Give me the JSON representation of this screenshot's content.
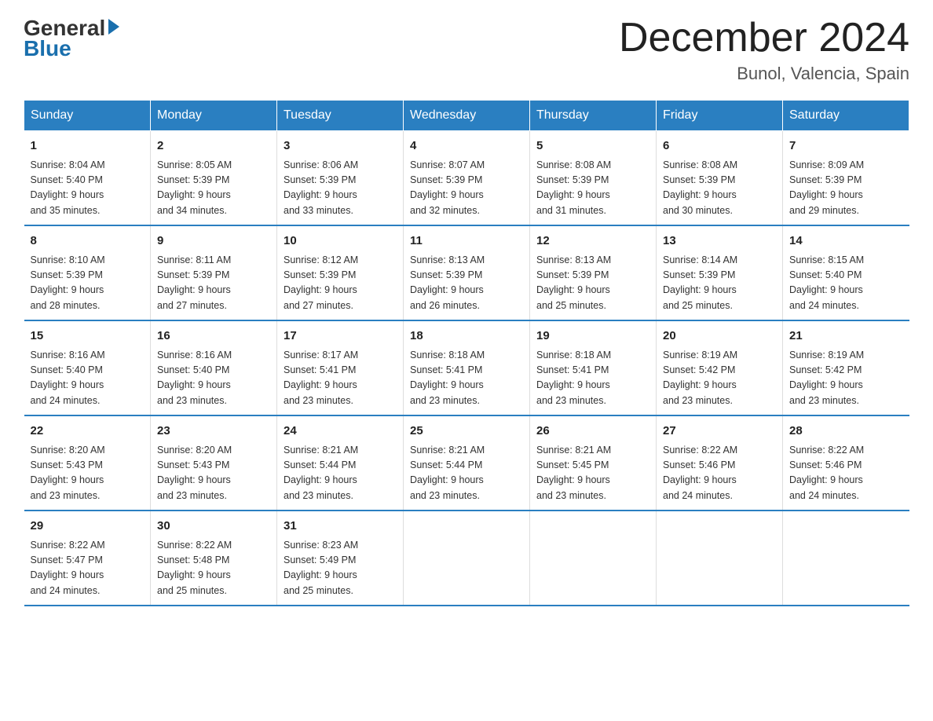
{
  "header": {
    "logo_text_general": "General",
    "logo_text_blue": "Blue",
    "month_title": "December 2024",
    "location": "Bunol, Valencia, Spain"
  },
  "days_of_week": [
    "Sunday",
    "Monday",
    "Tuesday",
    "Wednesday",
    "Thursday",
    "Friday",
    "Saturday"
  ],
  "weeks": [
    [
      {
        "day": "1",
        "info": "Sunrise: 8:04 AM\nSunset: 5:40 PM\nDaylight: 9 hours\nand 35 minutes."
      },
      {
        "day": "2",
        "info": "Sunrise: 8:05 AM\nSunset: 5:39 PM\nDaylight: 9 hours\nand 34 minutes."
      },
      {
        "day": "3",
        "info": "Sunrise: 8:06 AM\nSunset: 5:39 PM\nDaylight: 9 hours\nand 33 minutes."
      },
      {
        "day": "4",
        "info": "Sunrise: 8:07 AM\nSunset: 5:39 PM\nDaylight: 9 hours\nand 32 minutes."
      },
      {
        "day": "5",
        "info": "Sunrise: 8:08 AM\nSunset: 5:39 PM\nDaylight: 9 hours\nand 31 minutes."
      },
      {
        "day": "6",
        "info": "Sunrise: 8:08 AM\nSunset: 5:39 PM\nDaylight: 9 hours\nand 30 minutes."
      },
      {
        "day": "7",
        "info": "Sunrise: 8:09 AM\nSunset: 5:39 PM\nDaylight: 9 hours\nand 29 minutes."
      }
    ],
    [
      {
        "day": "8",
        "info": "Sunrise: 8:10 AM\nSunset: 5:39 PM\nDaylight: 9 hours\nand 28 minutes."
      },
      {
        "day": "9",
        "info": "Sunrise: 8:11 AM\nSunset: 5:39 PM\nDaylight: 9 hours\nand 27 minutes."
      },
      {
        "day": "10",
        "info": "Sunrise: 8:12 AM\nSunset: 5:39 PM\nDaylight: 9 hours\nand 27 minutes."
      },
      {
        "day": "11",
        "info": "Sunrise: 8:13 AM\nSunset: 5:39 PM\nDaylight: 9 hours\nand 26 minutes."
      },
      {
        "day": "12",
        "info": "Sunrise: 8:13 AM\nSunset: 5:39 PM\nDaylight: 9 hours\nand 25 minutes."
      },
      {
        "day": "13",
        "info": "Sunrise: 8:14 AM\nSunset: 5:39 PM\nDaylight: 9 hours\nand 25 minutes."
      },
      {
        "day": "14",
        "info": "Sunrise: 8:15 AM\nSunset: 5:40 PM\nDaylight: 9 hours\nand 24 minutes."
      }
    ],
    [
      {
        "day": "15",
        "info": "Sunrise: 8:16 AM\nSunset: 5:40 PM\nDaylight: 9 hours\nand 24 minutes."
      },
      {
        "day": "16",
        "info": "Sunrise: 8:16 AM\nSunset: 5:40 PM\nDaylight: 9 hours\nand 23 minutes."
      },
      {
        "day": "17",
        "info": "Sunrise: 8:17 AM\nSunset: 5:41 PM\nDaylight: 9 hours\nand 23 minutes."
      },
      {
        "day": "18",
        "info": "Sunrise: 8:18 AM\nSunset: 5:41 PM\nDaylight: 9 hours\nand 23 minutes."
      },
      {
        "day": "19",
        "info": "Sunrise: 8:18 AM\nSunset: 5:41 PM\nDaylight: 9 hours\nand 23 minutes."
      },
      {
        "day": "20",
        "info": "Sunrise: 8:19 AM\nSunset: 5:42 PM\nDaylight: 9 hours\nand 23 minutes."
      },
      {
        "day": "21",
        "info": "Sunrise: 8:19 AM\nSunset: 5:42 PM\nDaylight: 9 hours\nand 23 minutes."
      }
    ],
    [
      {
        "day": "22",
        "info": "Sunrise: 8:20 AM\nSunset: 5:43 PM\nDaylight: 9 hours\nand 23 minutes."
      },
      {
        "day": "23",
        "info": "Sunrise: 8:20 AM\nSunset: 5:43 PM\nDaylight: 9 hours\nand 23 minutes."
      },
      {
        "day": "24",
        "info": "Sunrise: 8:21 AM\nSunset: 5:44 PM\nDaylight: 9 hours\nand 23 minutes."
      },
      {
        "day": "25",
        "info": "Sunrise: 8:21 AM\nSunset: 5:44 PM\nDaylight: 9 hours\nand 23 minutes."
      },
      {
        "day": "26",
        "info": "Sunrise: 8:21 AM\nSunset: 5:45 PM\nDaylight: 9 hours\nand 23 minutes."
      },
      {
        "day": "27",
        "info": "Sunrise: 8:22 AM\nSunset: 5:46 PM\nDaylight: 9 hours\nand 24 minutes."
      },
      {
        "day": "28",
        "info": "Sunrise: 8:22 AM\nSunset: 5:46 PM\nDaylight: 9 hours\nand 24 minutes."
      }
    ],
    [
      {
        "day": "29",
        "info": "Sunrise: 8:22 AM\nSunset: 5:47 PM\nDaylight: 9 hours\nand 24 minutes."
      },
      {
        "day": "30",
        "info": "Sunrise: 8:22 AM\nSunset: 5:48 PM\nDaylight: 9 hours\nand 25 minutes."
      },
      {
        "day": "31",
        "info": "Sunrise: 8:23 AM\nSunset: 5:49 PM\nDaylight: 9 hours\nand 25 minutes."
      },
      {
        "day": "",
        "info": ""
      },
      {
        "day": "",
        "info": ""
      },
      {
        "day": "",
        "info": ""
      },
      {
        "day": "",
        "info": ""
      }
    ]
  ]
}
